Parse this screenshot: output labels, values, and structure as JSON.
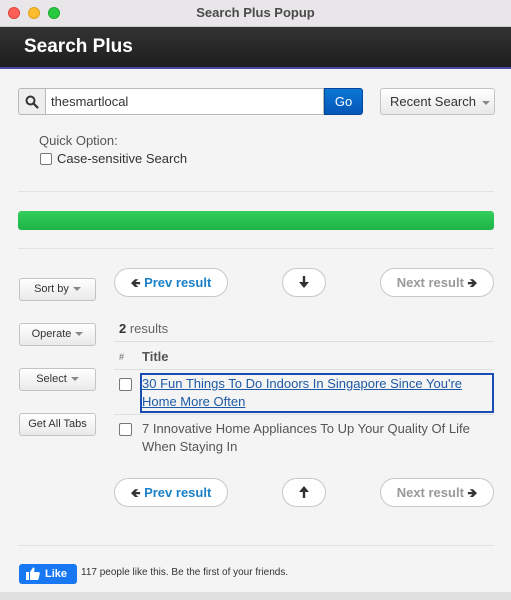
{
  "window": {
    "title": "Search Plus Popup"
  },
  "header": {
    "title": "Search Plus"
  },
  "search": {
    "value": "thesmartlocal",
    "go_label": "Go",
    "recent_label": "Recent Search"
  },
  "quick_option": {
    "label": "Quick Option:",
    "case_sensitive_label": "Case-sensitive Search",
    "case_sensitive_checked": false
  },
  "progress": {
    "percent": 100,
    "color": "#22c04e"
  },
  "sidebar": {
    "sort_label": "Sort by",
    "operate_label": "Operate",
    "select_label": "Select",
    "get_all_tabs_label": "Get All Tabs"
  },
  "nav_top": {
    "prev_label": "Prev result",
    "next_label": "Next result"
  },
  "nav_bottom": {
    "prev_label": "Prev result",
    "next_label": "Next result"
  },
  "results": {
    "count": "2",
    "count_suffix": " results",
    "col_hash": "#",
    "col_title": "Title",
    "rows": [
      {
        "title": "30 Fun Things To Do Indoors In Singapore Since You're Home More Often",
        "checked": false,
        "active": true
      },
      {
        "title": "7 Innovative Home Appliances To Up Your Quality Of Life When Staying In",
        "checked": false,
        "active": false
      }
    ]
  },
  "footer": {
    "like_label": "Like",
    "like_text": "117 people like this. Be the first of your friends."
  },
  "colors": {
    "accent": "#0a6fd0",
    "link": "#1a80c8",
    "progress": "#22c04e",
    "facebook": "#1877f2"
  }
}
